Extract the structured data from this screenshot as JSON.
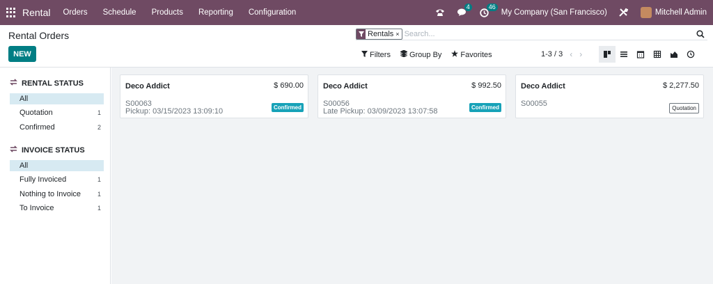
{
  "navbar": {
    "brand": "Rental",
    "menu": [
      "Orders",
      "Schedule",
      "Products",
      "Reporting",
      "Configuration"
    ],
    "messages_count": "4",
    "activities_count": "46",
    "company": "My Company (San Francisco)",
    "user": "Mitchell Admin"
  },
  "control": {
    "title": "Rental Orders",
    "new_label": "NEW",
    "facet_label": "Rentals",
    "facet_close": "×",
    "search_placeholder": "Search...",
    "filters_label": "Filters",
    "groupby_label": "Group By",
    "favorites_label": "Favorites",
    "pager": "1-3 / 3",
    "prev": "‹",
    "next": "›"
  },
  "side": {
    "rental_status": {
      "header": "RENTAL STATUS",
      "items": [
        {
          "label": "All",
          "count": ""
        },
        {
          "label": "Quotation",
          "count": "1"
        },
        {
          "label": "Confirmed",
          "count": "2"
        }
      ]
    },
    "invoice_status": {
      "header": "INVOICE STATUS",
      "items": [
        {
          "label": "All",
          "count": ""
        },
        {
          "label": "Fully Invoiced",
          "count": "1"
        },
        {
          "label": "Nothing to Invoice",
          "count": "1"
        },
        {
          "label": "To Invoice",
          "count": "1"
        }
      ]
    }
  },
  "cards": [
    {
      "partner": "Deco Addict",
      "amount": "$ 690.00",
      "ref": "S00063",
      "pickup": "Pickup: 03/15/2023 13:09:10",
      "status": "Confirmed"
    },
    {
      "partner": "Deco Addict",
      "amount": "$ 992.50",
      "ref": "S00056",
      "pickup": "Late Pickup: 03/09/2023 13:07:58",
      "status": "Confirmed"
    },
    {
      "partner": "Deco Addict",
      "amount": "$ 2,277.50",
      "ref": "S00055",
      "pickup": "",
      "status": "Quotation"
    }
  ],
  "colors": {
    "navbar": "#6f4a63",
    "primary": "#017e84",
    "confirmed_tag": "#17a2b8",
    "side_active": "#d7eaf2"
  },
  "icons": {
    "apps": "apps-grid-icon",
    "phone": "phone-icon",
    "chat": "chat-icon",
    "activity": "clock-icon",
    "debug": "tools-icon",
    "search": "search-icon",
    "filter": "funnel-icon",
    "groupby": "layers-icon",
    "favorites": "star-icon"
  }
}
